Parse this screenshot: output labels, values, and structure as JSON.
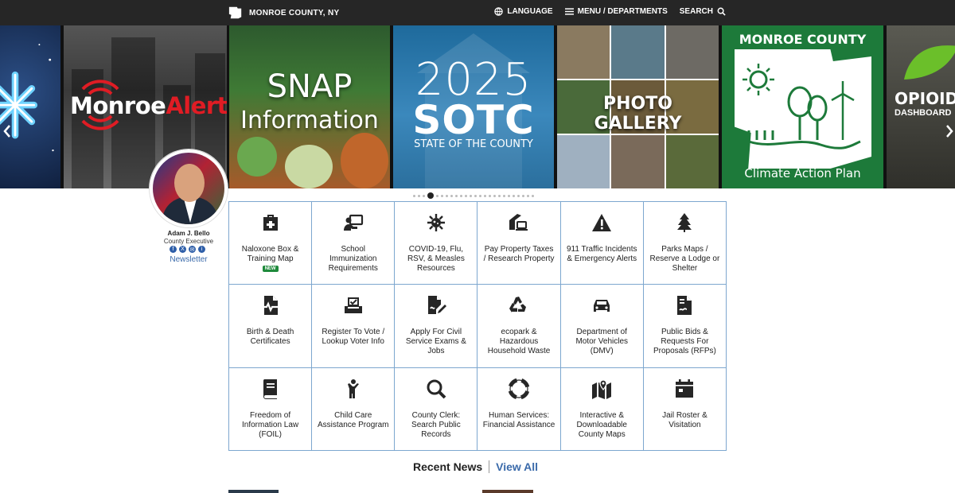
{
  "header": {
    "brand": "MONROE COUNTY, NY",
    "nav": {
      "language": "LANGUAGE",
      "menu": "MENU / DEPARTMENTS",
      "search": "SEARCH"
    }
  },
  "carousel": {
    "slides": {
      "alert": {
        "part1": "Monroe",
        "part2": "Alert"
      },
      "snap": {
        "line1": "SNAP",
        "line2": "Information"
      },
      "sotc": {
        "year": "2025",
        "big": "SOTC",
        "sub": "STATE OF THE COUNTY"
      },
      "gallery": {
        "title": "PHOTO GALLERY"
      },
      "climate": {
        "title": "MONROE COUNTY",
        "sub": "Climate Action Plan"
      },
      "opioid": {
        "title": "OPIOID",
        "sub": "DASHBOARD"
      }
    },
    "dot_count": 25,
    "active_dot": 3
  },
  "executive": {
    "name": "Adam J. Bello",
    "title": "County Executive",
    "newsletter": "Newsletter",
    "social": [
      "facebook-icon",
      "x-icon",
      "email-icon",
      "info-icon"
    ]
  },
  "tiles": [
    {
      "label": "Naloxone Box & Training Map",
      "icon": "medkit-icon",
      "badge": "NEW"
    },
    {
      "label": "School Immunization Requirements",
      "icon": "teacher-icon"
    },
    {
      "label": "COVID-19, Flu, RSV, & Measles Resources",
      "icon": "virus-icon"
    },
    {
      "label": "Pay Property Taxes / Research Property",
      "icon": "house-laptop-icon"
    },
    {
      "label": "911 Traffic Incidents & Emergency Alerts",
      "icon": "warning-icon"
    },
    {
      "label": "Parks Maps / Reserve a Lodge or Shelter",
      "icon": "tree-icon"
    },
    {
      "label": "Birth & Death Certificates",
      "icon": "file-waveform-icon"
    },
    {
      "label": "Register To Vote / Lookup Voter Info",
      "icon": "ballot-box-icon"
    },
    {
      "label": "Apply For Civil Service Exams & Jobs",
      "icon": "file-signature-icon"
    },
    {
      "label": "ecopark & Hazardous Household Waste",
      "icon": "recycle-icon"
    },
    {
      "label": "Department of Motor Vehicles (DMV)",
      "icon": "car-icon"
    },
    {
      "label": "Public Bids & Requests For Proposals (RFPs)",
      "icon": "file-contract-icon"
    },
    {
      "label": "Freedom of Information Law (FOIL)",
      "icon": "book-icon"
    },
    {
      "label": "Child Care Assistance Program",
      "icon": "child-icon"
    },
    {
      "label": "County Clerk: Search Public Records",
      "icon": "magnifier-icon"
    },
    {
      "label": "Human Services: Financial Assistance",
      "icon": "life-ring-icon"
    },
    {
      "label": "Interactive & Downloadable County Maps",
      "icon": "map-pin-icon"
    },
    {
      "label": "Jail Roster & Visitation",
      "icon": "calendar-icon"
    }
  ],
  "news": {
    "title": "Recent News",
    "view_all": "View All"
  }
}
